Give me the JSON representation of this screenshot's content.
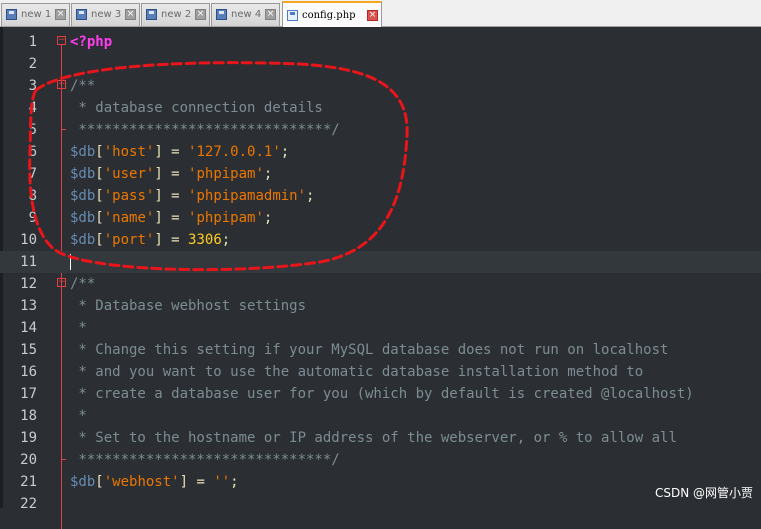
{
  "tabs": [
    {
      "label": "new 1"
    },
    {
      "label": "new 3"
    },
    {
      "label": "new 2"
    },
    {
      "label": "new 4"
    },
    {
      "label": "config.php",
      "active": true
    }
  ],
  "editor": {
    "lines": [
      {
        "num": "1",
        "tokens": [
          {
            "t": "<?php",
            "c": "tphp"
          }
        ],
        "fold": "open"
      },
      {
        "num": "2",
        "tokens": []
      },
      {
        "num": "3",
        "tokens": [
          {
            "t": "/**",
            "c": "tcom"
          }
        ],
        "fold": "open"
      },
      {
        "num": "4",
        "tokens": [
          {
            "t": " * database connection details",
            "c": "tcom"
          }
        ]
      },
      {
        "num": "5",
        "tokens": [
          {
            "t": " ******************************/",
            "c": "tcom"
          }
        ],
        "fold": "end"
      },
      {
        "num": "6",
        "tokens": [
          {
            "t": "$db",
            "c": "tvar"
          },
          {
            "t": "[",
            "c": "tpun"
          },
          {
            "t": "'host'",
            "c": "tstr"
          },
          {
            "t": "] = ",
            "c": "tpun"
          },
          {
            "t": "'127.0.0.1'",
            "c": "tstr"
          },
          {
            "t": ";",
            "c": "tpun"
          }
        ]
      },
      {
        "num": "7",
        "tokens": [
          {
            "t": "$db",
            "c": "tvar"
          },
          {
            "t": "[",
            "c": "tpun"
          },
          {
            "t": "'user'",
            "c": "tstr"
          },
          {
            "t": "] = ",
            "c": "tpun"
          },
          {
            "t": "'phpipam'",
            "c": "tstr"
          },
          {
            "t": ";",
            "c": "tpun"
          }
        ]
      },
      {
        "num": "8",
        "tokens": [
          {
            "t": "$db",
            "c": "tvar"
          },
          {
            "t": "[",
            "c": "tpun"
          },
          {
            "t": "'pass'",
            "c": "tstr"
          },
          {
            "t": "] = ",
            "c": "tpun"
          },
          {
            "t": "'phpipamadmin'",
            "c": "tstr"
          },
          {
            "t": ";",
            "c": "tpun"
          }
        ]
      },
      {
        "num": "9",
        "tokens": [
          {
            "t": "$db",
            "c": "tvar"
          },
          {
            "t": "[",
            "c": "tpun"
          },
          {
            "t": "'name'",
            "c": "tstr"
          },
          {
            "t": "] = ",
            "c": "tpun"
          },
          {
            "t": "'phpipam'",
            "c": "tstr"
          },
          {
            "t": ";",
            "c": "tpun"
          }
        ]
      },
      {
        "num": "10",
        "tokens": [
          {
            "t": "$db",
            "c": "tvar"
          },
          {
            "t": "[",
            "c": "tpun"
          },
          {
            "t": "'port'",
            "c": "tstr"
          },
          {
            "t": "] = ",
            "c": "tpun"
          },
          {
            "t": "3306",
            "c": "tnum"
          },
          {
            "t": ";",
            "c": "tpun"
          }
        ]
      },
      {
        "num": "11",
        "tokens": [],
        "current": true
      },
      {
        "num": "12",
        "tokens": [
          {
            "t": "/**",
            "c": "tcom"
          }
        ],
        "fold": "open"
      },
      {
        "num": "13",
        "tokens": [
          {
            "t": " * Database webhost settings",
            "c": "tcom"
          }
        ]
      },
      {
        "num": "14",
        "tokens": [
          {
            "t": " *",
            "c": "tcom"
          }
        ]
      },
      {
        "num": "15",
        "tokens": [
          {
            "t": " * Change this setting if your MySQL database does not run on localhost",
            "c": "tcom"
          }
        ]
      },
      {
        "num": "16",
        "tokens": [
          {
            "t": " * and you want to use the automatic database installation method to",
            "c": "tcom"
          }
        ]
      },
      {
        "num": "17",
        "tokens": [
          {
            "t": " * create a database user for you (which by default is created @localhost)",
            "c": "tcom"
          }
        ]
      },
      {
        "num": "18",
        "tokens": [
          {
            "t": " *",
            "c": "tcom"
          }
        ]
      },
      {
        "num": "19",
        "tokens": [
          {
            "t": " * Set to the hostname or IP address of the webserver, or % to allow all",
            "c": "tcom"
          }
        ]
      },
      {
        "num": "20",
        "tokens": [
          {
            "t": " ******************************/",
            "c": "tcom"
          }
        ],
        "fold": "end"
      },
      {
        "num": "21",
        "tokens": [
          {
            "t": "$db",
            "c": "tvar"
          },
          {
            "t": "[",
            "c": "tpun"
          },
          {
            "t": "'webhost'",
            "c": "tstr"
          },
          {
            "t": "] = ",
            "c": "tpun"
          },
          {
            "t": "''",
            "c": "tstr"
          },
          {
            "t": ";",
            "c": "tpun"
          }
        ]
      },
      {
        "num": "22",
        "tokens": []
      }
    ]
  },
  "watermark": "CSDN @网管小贾",
  "colors": {
    "background": "#2b2f33",
    "php_tag": "#ff3df0",
    "variable": "#678cb1",
    "string": "#ec7600",
    "number": "#ffcd22",
    "comment": "#7d8c93",
    "annotation": "#e8151b"
  }
}
